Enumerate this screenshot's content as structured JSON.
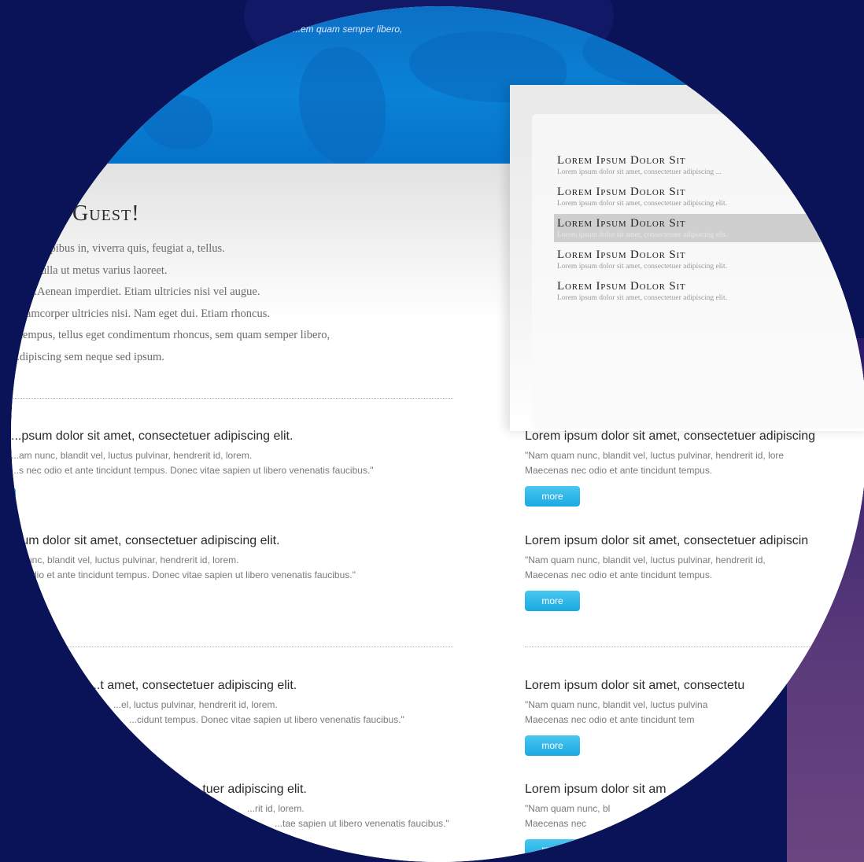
{
  "banner": {
    "tagline": "...em quam semper libero,"
  },
  "welcome": {
    "title": "Guest!",
    "lines": [
      "...nte, dapibus in, viverra quis, feugiat a, tellus.",
      "...rra nulla ut metus varius laoreet.",
      "...um.Aenean imperdiet. Etiam ultricies nisi vel augue.",
      "...llamcorper ultricies nisi. Nam eget dui. Etiam rhoncus.",
      "...tempus, tellus eget condimentum rhoncus, sem quam semper libero,",
      "...dipiscing sem neque sed ipsum."
    ]
  },
  "sidebar": {
    "items": [
      {
        "title": "Lorem Ipsum Dolor Sit",
        "sub": "Lorem ipsum dolor sit amet, consectetuer adipiscing ..."
      },
      {
        "title": "Lorem Ipsum Dolor Sit",
        "sub": "Lorem ipsum dolor sit amet, consectetuer adipiscing elit."
      },
      {
        "title": "Lorem Ipsum Dolor Sit",
        "sub": "Lorem ipsum dolor sit amet, consectetuer adipiscing elit."
      },
      {
        "title": "Lorem Ipsum Dolor Sit",
        "sub": "Lorem ipsum dolor sit amet, consectetuer adipiscing elit."
      },
      {
        "title": "Lorem Ipsum Dolor Sit",
        "sub": "Lorem ipsum dolor sit amet, consectetuer adipiscing elit."
      }
    ]
  },
  "articles_left": [
    {
      "title": "...psum dolor sit amet, consectetuer adipiscing elit.",
      "line1": "...am nunc, blandit vel, luctus pulvinar, hendrerit id, lorem.",
      "line2": "...s nec odio et ante tincidunt tempus. Donec vitae sapien ut libero venenatis faucibus.\""
    },
    {
      "title": "...um dolor sit amet, consectetuer adipiscing elit.",
      "line1": "... nunc, blandit vel, luctus pulvinar, hendrerit id, lorem.",
      "line2": "...c odio et ante tincidunt tempus. Donec vitae sapien ut libero venenatis faucibus.\""
    },
    {
      "title": "...t amet, consectetuer adipiscing elit.",
      "line1": "...el, luctus pulvinar, hendrerit id, lorem.",
      "line2": "...cidunt tempus. Donec vitae sapien ut libero venenatis faucibus.\""
    },
    {
      "title": "...tuer adipiscing elit.",
      "line1": "...rit id, lorem.",
      "line2": "...tae sapien ut libero venenatis faucibus.\""
    }
  ],
  "articles_right": [
    {
      "title": "Lorem ipsum dolor sit amet, consectetuer adipiscing",
      "line1": "\"Nam quam nunc, blandit vel, luctus pulvinar, hendrerit id, lore",
      "line2": "Maecenas nec odio et ante tincidunt tempus.",
      "button": "more"
    },
    {
      "title": "Lorem ipsum dolor sit amet, consectetuer adipiscin",
      "line1": "\"Nam quam nunc, blandit vel, luctus pulvinar, hendrerit id,",
      "line2": "Maecenas nec odio et ante tincidunt tempus.",
      "button": "more"
    },
    {
      "title": "Lorem ipsum dolor sit amet, consectetu",
      "line1": "\"Nam quam nunc, blandit vel, luctus pulvina",
      "line2": "Maecenas nec odio et ante tincidunt tem",
      "button": "more"
    },
    {
      "title": "Lorem ipsum dolor sit am",
      "line1": "\"Nam quam nunc, bl",
      "line2": "Maecenas nec",
      "button": "more"
    }
  ]
}
